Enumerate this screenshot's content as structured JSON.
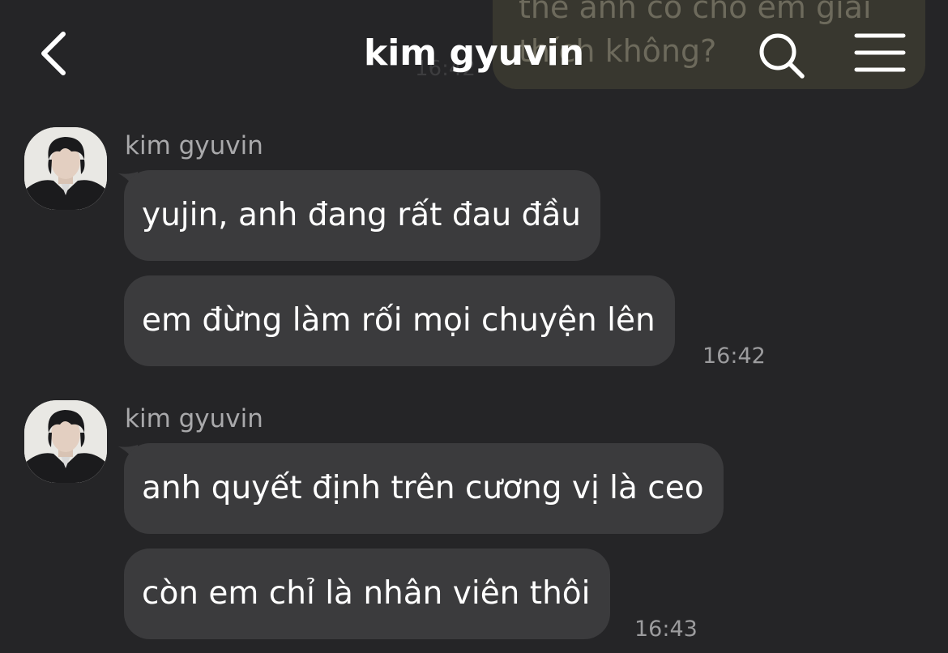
{
  "header": {
    "title": "kim gyuvin",
    "back_icon": "chevron-left-icon",
    "search_icon": "search-icon",
    "menu_icon": "hamburger-menu-icon"
  },
  "background_sent": {
    "text": "thế anh có cho em giải thích không?",
    "time": "16:42"
  },
  "messages": [
    {
      "sender": "kim gyuvin",
      "bubbles": [
        "yujin, anh đang rất đau đầu",
        "em đừng làm rối mọi chuyện lên"
      ],
      "time": "16:42"
    },
    {
      "sender": "kim gyuvin",
      "bubbles": [
        "anh quyết định trên cương vị là ceo",
        "còn em chỉ là nhân viên thôi"
      ],
      "time": "16:43"
    }
  ],
  "colors": {
    "background": "#252527",
    "bubble": "#3b3b3d",
    "sent_bubble": "#38372f",
    "text": "#ffffff",
    "muted": "#a9a9ab"
  }
}
